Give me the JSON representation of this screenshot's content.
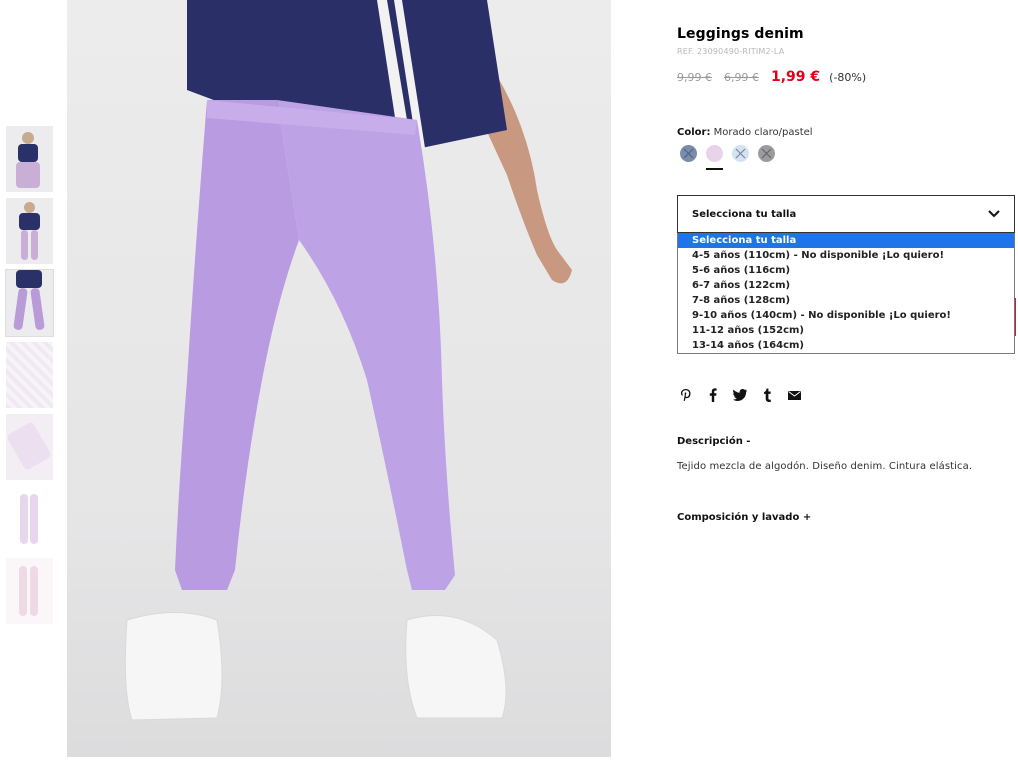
{
  "product": {
    "title": "Leggings denim",
    "ref": "REF. 23090490-RITIM2-LA",
    "price_original": "9,99 €",
    "price_previous": "6,99 €",
    "price_sale": "1,99 €",
    "discount": "(-80%)",
    "accent_color": "#e1001a"
  },
  "color": {
    "label": "Color:",
    "value": "Morado claro/pastel",
    "swatches": [
      {
        "name": "denim-blue",
        "color": "#7a8cae"
      },
      {
        "name": "light-purple",
        "color": "#e7d3ea"
      },
      {
        "name": "light-blue",
        "color": "#d3e3f1"
      },
      {
        "name": "grey",
        "color": "#9c9c9c"
      }
    ]
  },
  "size": {
    "placeholder": "Selecciona tu talla",
    "options": [
      "Selecciona tu talla",
      "4-5 años (110cm) - No disponible ¡Lo quiero!",
      "5-6 años (116cm)",
      "6-7 años (122cm)",
      "7-8 años (128cm)",
      "9-10 años (140cm) - No disponible ¡Lo quiero!",
      "11-12 años (152cm)",
      "13-14 años (164cm)"
    ],
    "highlight_color": "#1e74e8"
  },
  "share": [
    "pinterest-icon",
    "facebook-icon",
    "twitter-icon",
    "tumblr-icon",
    "email-icon"
  ],
  "description": {
    "heading": "Descripción -",
    "text": "Tejido mezcla de algodón. Diseño denim. Cintura elástica."
  },
  "composition": {
    "heading": "Composición y lavado +"
  }
}
